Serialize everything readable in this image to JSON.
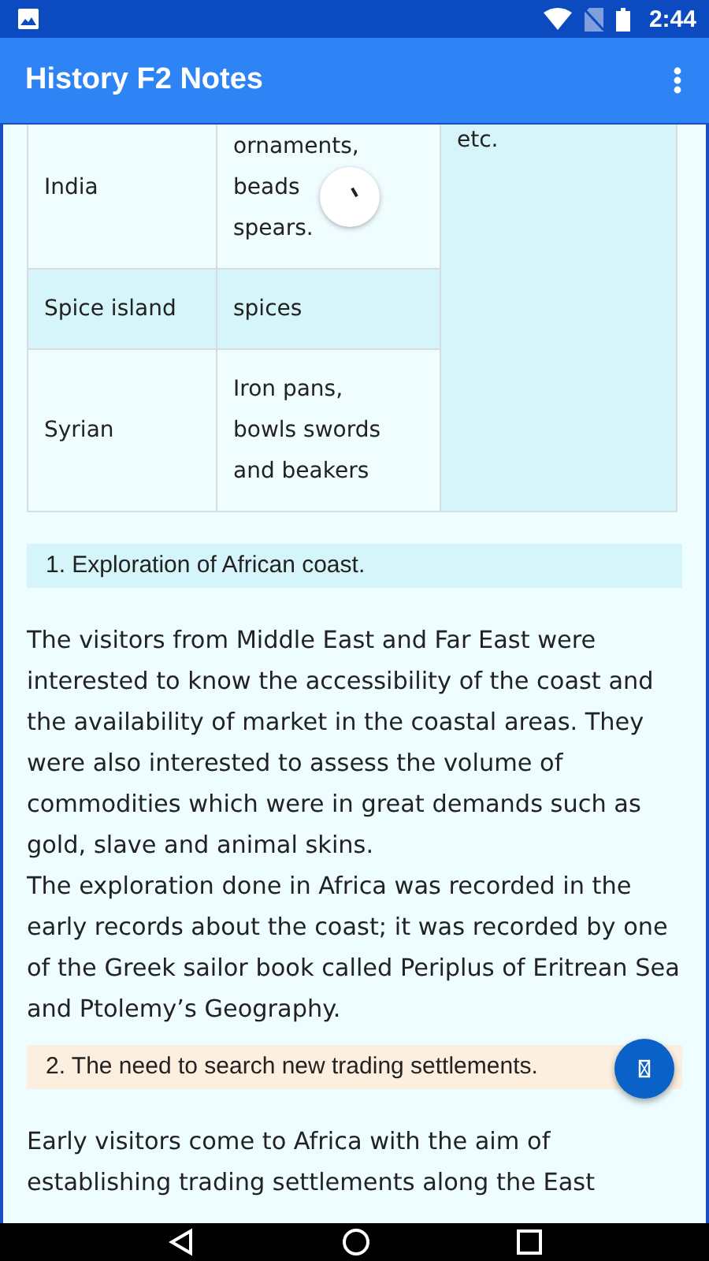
{
  "status_bar": {
    "time": "2:44"
  },
  "app_bar": {
    "title": "History F2 Notes"
  },
  "table": {
    "rows": [
      {
        "cells": [
          [
            "India"
          ],
          [
            "ornaments,",
            "beads",
            "spears."
          ]
        ],
        "shaded": false
      },
      {
        "cells": [
          [
            "Spice island"
          ],
          [
            "spices"
          ]
        ],
        "shaded": true
      },
      {
        "cells": [
          [
            "Syrian"
          ],
          [
            "Iron pans,",
            "bowls swords",
            "and beakers"
          ]
        ],
        "shaded": false
      }
    ],
    "side_column": {
      "text": "etc."
    }
  },
  "loading_indicator": true,
  "sections": [
    {
      "kind": "heading",
      "text": "1. Exploration of African coast.",
      "color": "#d6f5fa"
    },
    {
      "kind": "paragraph",
      "text": "The visitors from Middle East and Far East were interested to know the accessibility of the coast and the availability of market in the coastal areas. They were also interested to assess the volume of commodities which were in great demands such as gold, slave and animal skins."
    },
    {
      "kind": "paragraph",
      "text": "The exploration done in Africa was recorded in the early records about the coast; it was recorded by one of the Greek sailor book called Periplus of Eritrean Sea and Ptolemy’s Geography."
    },
    {
      "kind": "heading",
      "text": "2. The need to search new trading settlements.",
      "color": "#fcefdf"
    },
    {
      "kind": "paragraph",
      "text": "Early visitors come to Africa with the aim of establishing trading settlements along the East"
    }
  ]
}
